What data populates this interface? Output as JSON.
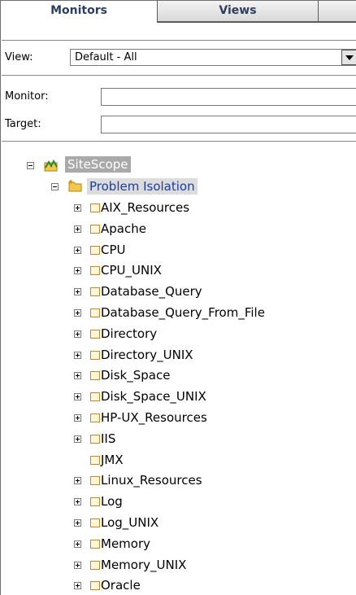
{
  "tabs": [
    {
      "label": "Monitors",
      "active": true
    },
    {
      "label": "Views",
      "active": false
    },
    {
      "label": "",
      "active": false
    }
  ],
  "view": {
    "label": "View:",
    "selected": "Default - All"
  },
  "filters": {
    "monitor_label": "Monitor:",
    "monitor_value": "",
    "target_label": "Target:",
    "target_value": ""
  },
  "tree": {
    "root": {
      "label": "SiteScope",
      "icon": "sitescope-icon",
      "expanded": true
    },
    "folder": {
      "label": "Problem Isolation",
      "icon": "folder-icon",
      "expanded": true
    },
    "groups": [
      {
        "label": "AIX_Resources",
        "expandable": true
      },
      {
        "label": "Apache",
        "expandable": true
      },
      {
        "label": "CPU",
        "expandable": true
      },
      {
        "label": "CPU_UNIX",
        "expandable": true
      },
      {
        "label": "Database_Query",
        "expandable": true
      },
      {
        "label": "Database_Query_From_File",
        "expandable": true
      },
      {
        "label": "Directory",
        "expandable": true
      },
      {
        "label": "Directory_UNIX",
        "expandable": true
      },
      {
        "label": "Disk_Space",
        "expandable": true
      },
      {
        "label": "Disk_Space_UNIX",
        "expandable": true
      },
      {
        "label": "HP-UX_Resources",
        "expandable": true
      },
      {
        "label": "IIS",
        "expandable": true
      },
      {
        "label": "JMX",
        "expandable": false
      },
      {
        "label": "Linux_Resources",
        "expandable": true
      },
      {
        "label": "Log",
        "expandable": true
      },
      {
        "label": "Log_UNIX",
        "expandable": true
      },
      {
        "label": "Memory",
        "expandable": true
      },
      {
        "label": "Memory_UNIX",
        "expandable": true
      },
      {
        "label": "Oracle",
        "expandable": true
      }
    ]
  },
  "colors": {
    "group_border": "#c9862d",
    "folder_text": "#1a3ea0",
    "tab_text": "#2c3f5e"
  }
}
